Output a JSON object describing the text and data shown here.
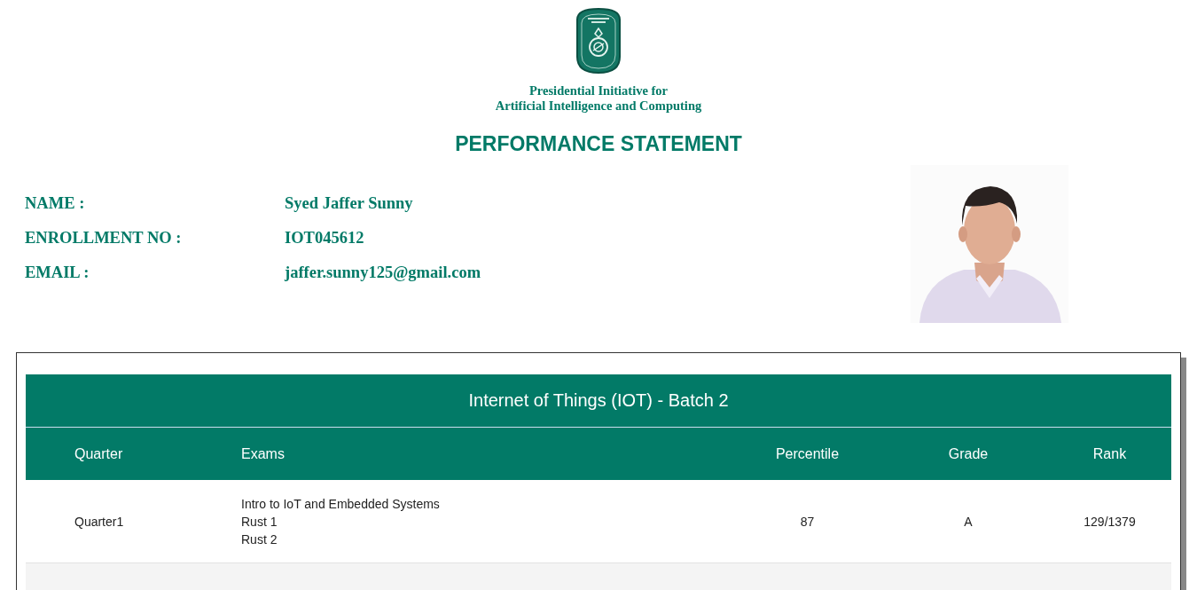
{
  "organization": {
    "line_1": "Presidential Initiative for",
    "line_2": "Artificial Intelligence and Computing"
  },
  "title": "PERFORMANCE STATEMENT",
  "student": [
    {
      "label": "NAME :",
      "value": "Syed Jaffer Sunny"
    },
    {
      "label": "ENROLLMENT NO :",
      "value": "IOT045612"
    },
    {
      "label": "EMAIL :",
      "value": "jaffer.sunny125@gmail.com"
    }
  ],
  "table": {
    "title": "Internet of Things (IOT) - Batch 2",
    "columns": [
      "Quarter",
      "Exams",
      "Percentile",
      "Grade",
      "Rank"
    ],
    "rows": [
      {
        "quarter": "Quarter1",
        "exams": [
          "Intro to IoT and Embedded Systems",
          "Rust 1",
          "Rust 2"
        ],
        "percentile": "87",
        "grade": "A",
        "rank": "129/1379"
      }
    ]
  }
}
